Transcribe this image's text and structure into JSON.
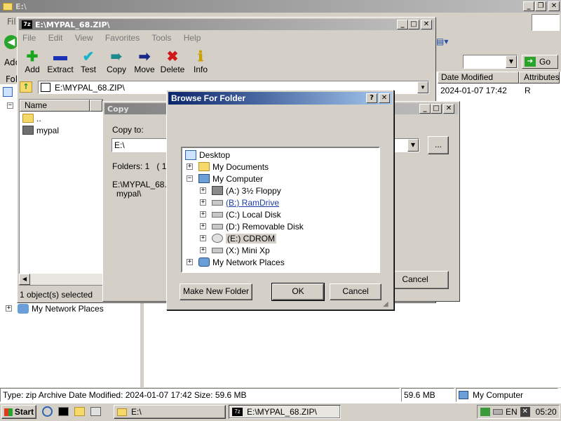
{
  "explorer": {
    "title": "E:\\",
    "address_label": "Add",
    "folders_label": "Fol",
    "file_label": "Fil",
    "go_label": "Go",
    "columns": [
      "Date Modified",
      "Attributes"
    ],
    "row": {
      "date": "2024-01-07 17:42",
      "attr": "R"
    },
    "tree_network": "My Network Places"
  },
  "zip_window": {
    "title": "E:\\MYPAL_68.ZIP\\",
    "menu": [
      "File",
      "Edit",
      "View",
      "Favorites",
      "Tools",
      "Help"
    ],
    "toolbar": [
      {
        "label": "Add",
        "icon": "plus-icon",
        "color": "#1aa61a"
      },
      {
        "label": "Extract",
        "icon": "minus-icon",
        "color": "#1c32b4"
      },
      {
        "label": "Test",
        "icon": "check-icon",
        "color": "#1ab4c8"
      },
      {
        "label": "Copy",
        "icon": "double-arrow-icon",
        "color": "#1a8a8a"
      },
      {
        "label": "Move",
        "icon": "arrow-right-icon",
        "color": "#1a2a8a"
      },
      {
        "label": "Delete",
        "icon": "x-icon",
        "color": "#d01818"
      },
      {
        "label": "Info",
        "icon": "info-icon",
        "color": "#c8a000"
      }
    ],
    "path": "E:\\MYPAL_68.ZIP\\",
    "column_name": "Name",
    "items": [
      "..",
      "mypal"
    ],
    "status": "1 object(s) selected"
  },
  "copy_dialog": {
    "title": "Copy",
    "copy_to_label": "Copy to:",
    "dest_value": "E:\\",
    "browse_label": "...",
    "info_folders": "Folders: 1   ( 16",
    "info_path": "E:\\MYPAL_68.Z",
    "info_item": "mypal\\",
    "cancel_label": "Cancel"
  },
  "browse_dialog": {
    "title": "Browse For Folder",
    "help_label": "?",
    "close_label": "✕",
    "tree": [
      {
        "label": "Desktop",
        "level": 0,
        "expander": "",
        "icon": "desktop-icon"
      },
      {
        "label": "My Documents",
        "level": 1,
        "expander": "+",
        "icon": "folder-icon"
      },
      {
        "label": "My Computer",
        "level": 1,
        "expander": "−",
        "icon": "computer-icon"
      },
      {
        "label": "(A:) 3½ Floppy",
        "level": 2,
        "expander": "+",
        "icon": "floppy-icon"
      },
      {
        "label": "(B:) RamDrive",
        "level": 2,
        "expander": "+",
        "icon": "drive-icon"
      },
      {
        "label": "(C:) Local Disk",
        "level": 2,
        "expander": "+",
        "icon": "drive-icon"
      },
      {
        "label": "(D:) Removable Disk",
        "level": 2,
        "expander": "+",
        "icon": "drive-icon"
      },
      {
        "label": "(E:) CDROM",
        "level": 2,
        "expander": "+",
        "icon": "cdrom-icon"
      },
      {
        "label": "(X:) Mini Xp",
        "level": 2,
        "expander": "+",
        "icon": "drive-icon"
      },
      {
        "label": "My Network Places",
        "level": 1,
        "expander": "+",
        "icon": "network-icon"
      }
    ],
    "make_folder_label": "Make New Folder",
    "ok_label": "OK",
    "cancel_label": "Cancel"
  },
  "statusbar": {
    "info": "Type: zip Archive Date Modified: 2024-01-07 17:42 Size: 59.6 MB",
    "size": "59.6 MB",
    "location": "My Computer"
  },
  "taskbar": {
    "start_label": "Start",
    "tasks": [
      "E:\\",
      "E:\\MYPAL_68.ZIP\\"
    ],
    "tray_lang": "EN",
    "clock": "05:20"
  }
}
